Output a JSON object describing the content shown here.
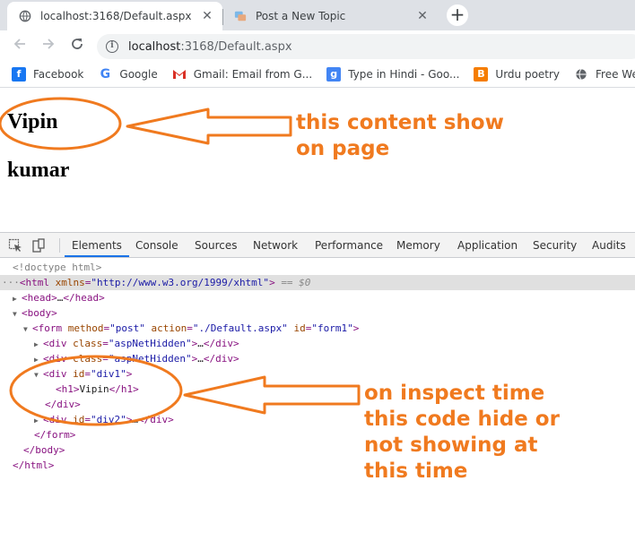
{
  "tabs": [
    {
      "title": "localhost:3168/Default.aspx",
      "active": true
    },
    {
      "title": "Post a New Topic",
      "active": false
    }
  ],
  "new_tab_label": "+",
  "address_bar": {
    "host": "localhost",
    "path": ":3168/Default.aspx"
  },
  "bookmarks": [
    {
      "label": "Facebook",
      "icon": "facebook-icon",
      "color": "#1877f2"
    },
    {
      "label": "Google",
      "icon": "google-icon",
      "color": "#4285f4"
    },
    {
      "label": "Gmail: Email from G...",
      "icon": "gmail-icon",
      "color": "#d93025"
    },
    {
      "label": "Type in Hindi - Goo...",
      "icon": "google-input-icon",
      "color": "#4285f4"
    },
    {
      "label": "Urdu poetry",
      "icon": "blogger-icon",
      "color": "#f57d00"
    },
    {
      "label": "Free Website Ter",
      "icon": "globe-icon",
      "color": "#5f6368"
    }
  ],
  "page": {
    "heading1": "Vipin",
    "heading2": "kumar"
  },
  "annotations": {
    "top_line1": "this content show",
    "top_line2": "on page",
    "bottom_line1": "on inspect time",
    "bottom_line2": "this code hide or",
    "bottom_line3": "not showing at",
    "bottom_line4": "this time",
    "color": "#f07a1f"
  },
  "devtools": {
    "tabs": [
      "Elements",
      "Console",
      "Sources",
      "Network",
      "Performance",
      "Memory",
      "Application",
      "Security",
      "Audits"
    ],
    "active_tab": "Elements",
    "doctype": "<!doctype html>",
    "html_tag": "html",
    "html_attr_name": "xmlns",
    "html_attr_value": "\"http://www.w3.org/1999/xhtml\"",
    "selected_marker": "== $0",
    "head_tag": "head",
    "body_tag": "body",
    "form_tag": "form",
    "form_attrs": [
      {
        "name": "method",
        "value": "\"post\""
      },
      {
        "name": "action",
        "value": "\"./Default.aspx\""
      },
      {
        "name": "id",
        "value": "\"form1\""
      }
    ],
    "div_tag": "div",
    "class_attr": "class",
    "hidden_value": "\"aspNetHidden\"",
    "id_attr": "id",
    "div1_value": "\"div1\"",
    "h1_tag": "h1",
    "h1_text": "Vipin",
    "div2_value": "\"div2\"",
    "ellipsis": "…"
  }
}
